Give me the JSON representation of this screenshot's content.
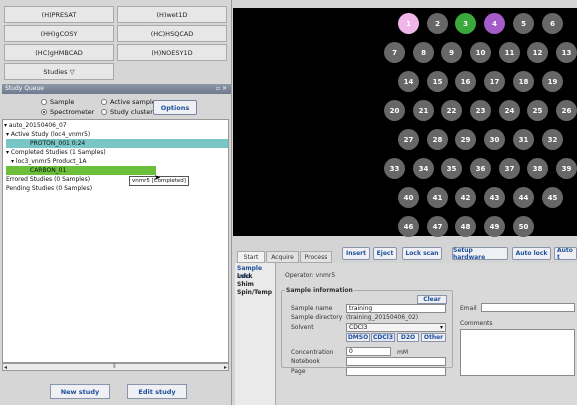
{
  "experiments": [
    {
      "label": "(H)PRESAT"
    },
    {
      "label": "(H)wet1D"
    },
    {
      "label": "(HH)gCOSY"
    },
    {
      "label": "(HC)HSQCAD"
    },
    {
      "label": "(HC)gHMBCAD"
    },
    {
      "label": "(H)NOESY1D"
    },
    {
      "label": "Studies ▽"
    }
  ],
  "queue": {
    "title": "Study Queue",
    "controls": "▫ ×",
    "radio_sample": "Sample",
    "radio_active": "Active sample",
    "radio_spectrometer": "Spectrometer",
    "radio_cluster": "Study cluster",
    "options_label": "Options",
    "tree": [
      {
        "text": "▾ auto_20150406_07"
      },
      {
        "text": "▾ Active Study (loc4_vnmr5)"
      },
      {
        "text": "PROTON_001 0:24"
      },
      {
        "text": "▾ Completed Studies (1 Samples)"
      },
      {
        "text": "▾ loc3_vnmr5 Product_1A"
      },
      {
        "text": "CARBON_01"
      },
      {
        "text": "Errored Studies (0 Samples)"
      },
      {
        "text": "Pending Studies (0 Samples)"
      }
    ],
    "tooltip": "vnmr5 [Completed]",
    "new_study": "New study",
    "edit_study": "Edit study"
  },
  "plate": {
    "wells": [
      "1",
      "2",
      "3",
      "4",
      "5",
      "6",
      "7",
      "8",
      "9",
      "10",
      "11",
      "12",
      "13",
      "14",
      "15",
      "16",
      "17",
      "18",
      "19",
      "20",
      "21",
      "22",
      "23",
      "24",
      "25",
      "26",
      "27",
      "28",
      "29",
      "30",
      "31",
      "32",
      "33",
      "34",
      "35",
      "36",
      "37",
      "38",
      "39",
      "40",
      "41",
      "42",
      "43",
      "44",
      "45",
      "46",
      "47",
      "48",
      "49",
      "50"
    ],
    "well_colors": {
      "default": "#676767",
      "1": "#f0b6e8",
      "3": "#3aa83a",
      "4": "#a35cc8"
    }
  },
  "tabs": [
    {
      "label": "Start"
    },
    {
      "label": "Acquire"
    },
    {
      "label": "Process"
    }
  ],
  "toolbar": {
    "insert": "Insert",
    "eject": "Eject",
    "lock_scan": "Lock scan",
    "setup_hardware": "Setup hardware",
    "auto_lock": "Auto lock",
    "auto_t": "Auto t"
  },
  "side_items": [
    {
      "label": "Sample info"
    },
    {
      "label": "Lock"
    },
    {
      "label": "Shim"
    },
    {
      "label": "Spin/Temp"
    }
  ],
  "form": {
    "operator_label": "Operator: vnmr5",
    "section_title": "Sample information",
    "clear": "Clear",
    "sample_name_label": "Sample name",
    "sample_name_value": "training",
    "sample_dir_label": "Sample directory",
    "sample_dir_value": "(training_20150406_02)",
    "solvent_label": "Solvent",
    "solvent_value": "CDCl3",
    "solvent_buttons": [
      "DMSO",
      "CDCl3",
      "D2O",
      "Other"
    ],
    "concentration_label": "Concentration",
    "concentration_value": "0",
    "concentration_unit": "mM",
    "notebook_label": "Notebook",
    "page_label": "Page",
    "email_label": "Email",
    "comments_label": "Comments"
  }
}
